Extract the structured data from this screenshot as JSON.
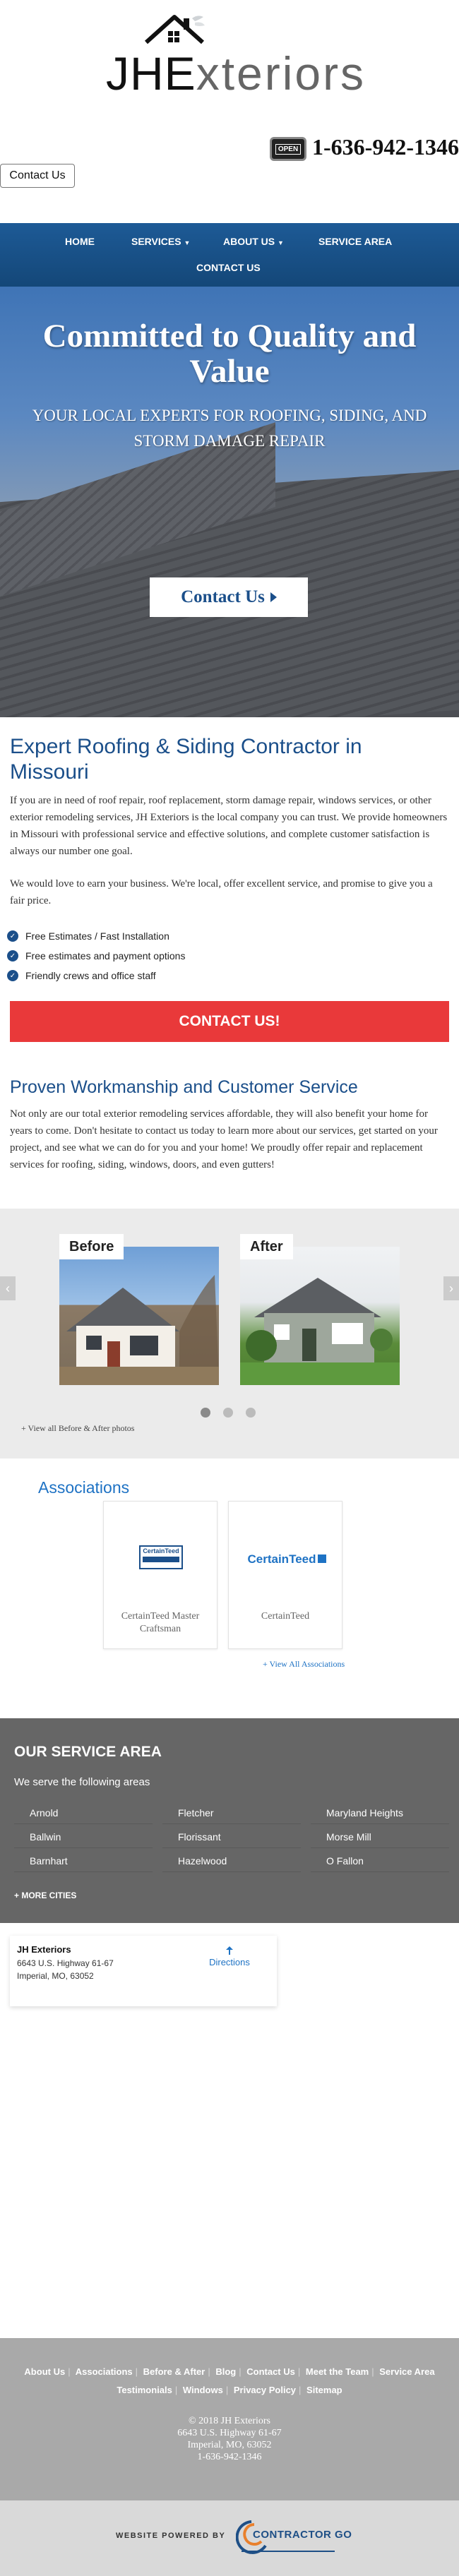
{
  "brand": {
    "logo_text_bold": "JHE",
    "logo_text_light": "xteriors",
    "open_sign": "OPEN",
    "phone": "1-636-942-1346",
    "header_contact_button": "Contact Us"
  },
  "nav": {
    "items": [
      {
        "label": "HOME",
        "has_dropdown": false
      },
      {
        "label": "SERVICES",
        "has_dropdown": true
      },
      {
        "label": "ABOUT US",
        "has_dropdown": true
      },
      {
        "label": "SERVICE AREA",
        "has_dropdown": false
      },
      {
        "label": "CONTACT US",
        "has_dropdown": false
      }
    ]
  },
  "hero": {
    "title": "Committed to Quality and Value",
    "subtitle": "YOUR LOCAL EXPERTS FOR ROOFING, SIDING, AND STORM DAMAGE REPAIR",
    "button": "Contact Us"
  },
  "intro": {
    "title": "Expert Roofing & Siding Contractor in Missouri",
    "paragraph1": "If you are in need of roof repair, roof replacement, storm damage repair, windows services, or other exterior remodeling services, JH Exteriors is the local company you can trust. We provide homeowners in Missouri with professional service and effective solutions, and complete customer satisfaction is always our number one goal.",
    "paragraph2": "We would love to earn your business. We're local, offer excellent service, and promise to give you a fair price.",
    "checklist": [
      "Free Estimates / Fast Installation",
      "Free estimates and payment options",
      "Friendly crews and office staff"
    ],
    "cta": "CONTACT US!"
  },
  "proven": {
    "title": "Proven Workmanship and Customer Service",
    "paragraph": "Not only are our total exterior remodeling services affordable, they will also benefit your home for years to come. Don't hesitate to contact us today to learn more about our services, get started on your project, and see what we can do for you and your home! We proudly offer repair and replacement services for roofing, siding, windows, doors, and even gutters!"
  },
  "before_after": {
    "before_label": "Before",
    "after_label": "After",
    "view_all": "+ View all Before & After photos",
    "slides": 3,
    "active_slide": 1
  },
  "associations": {
    "title": "Associations",
    "items": [
      {
        "name": "CertainTeed Master Craftsman",
        "logo_text": "CertainTeed"
      },
      {
        "name": "CertainTeed",
        "logo_text": "CertainTeed"
      }
    ],
    "view_all": "+ View All Associations"
  },
  "service_area": {
    "title": "OUR SERVICE AREA",
    "subtitle": "We serve the following areas",
    "cities": [
      "Arnold",
      "Fletcher",
      "Maryland Heights",
      "Ballwin",
      "Florissant",
      "Morse Mill",
      "Barnhart",
      "Hazelwood",
      "O Fallon"
    ],
    "more": "+ MORE CITIES"
  },
  "location": {
    "name": "JH Exteriors",
    "address1": "6643 U.S. Highway 61-67",
    "address2": "Imperial, MO, 63052",
    "directions": "Directions"
  },
  "footer": {
    "links_row1": [
      "About Us",
      "Associations",
      "Before & After",
      "Blog",
      "Contact Us",
      "Meet the Team",
      "Service Area"
    ],
    "links_row2": [
      "Testimonials",
      "Windows",
      "Privacy Policy",
      "Sitemap"
    ],
    "copyright": "© 2018 JH Exteriors",
    "address1": "6643 U.S. Highway 61-67",
    "address2": "Imperial, MO, 63052",
    "phone": "1-636-942-1346",
    "powered_by": "WEBSITE POWERED BY",
    "powered_logo": "CONTRACTOR GO"
  },
  "colors": {
    "nav_blue": "#1a5088",
    "heading_blue": "#1b4f8a",
    "cta_red": "#e9393a",
    "service_area_gray": "#666666",
    "footer_gray": "#a9a9a9"
  }
}
